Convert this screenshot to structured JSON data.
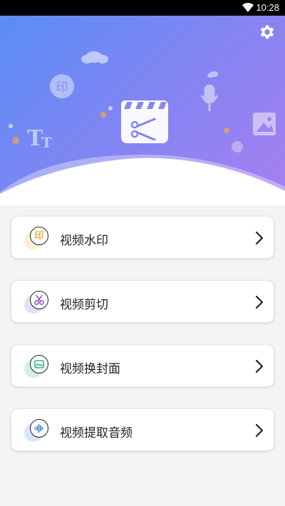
{
  "status_bar": {
    "time": "10:28"
  },
  "banner": {
    "deco_glyph_yin": "印",
    "deco_glyph_tt": "T"
  },
  "menu": {
    "items": [
      {
        "label": "视频水印",
        "icon": "watermark-icon",
        "glyph": "印",
        "accent": "#f2b233",
        "blob": "#fcefd6"
      },
      {
        "label": "视频剪切",
        "icon": "scissors-icon",
        "accent": "#9b59c4",
        "blob": "#eadcf3"
      },
      {
        "label": "视频换封面",
        "icon": "cover-image-icon",
        "accent": "#2fb57d",
        "blob": "#d4f0e3"
      },
      {
        "label": "视频提取音频",
        "icon": "audio-wave-icon",
        "accent": "#3a7be0",
        "blob": "#d8e6fb"
      }
    ]
  }
}
